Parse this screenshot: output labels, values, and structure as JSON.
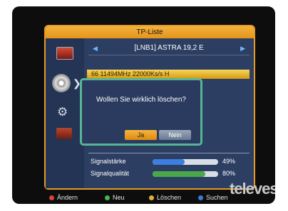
{
  "window": {
    "title": "TP-Liste"
  },
  "satellite": {
    "label": "[LNB1] ASTRA  19,2 E"
  },
  "transponder": {
    "row": "66    11494MHz  22000Ks/s      H"
  },
  "dialog": {
    "question": "Wollen Sie wirklich löschen?",
    "yes": "Ja",
    "no": "Nein"
  },
  "signal": {
    "strength_label": "Signalstärke",
    "strength_value": 49,
    "strength_text": "49%",
    "quality_label": "Signalqualität",
    "quality_value": 80,
    "quality_text": "80%"
  },
  "legend": [
    {
      "label": "Ändern",
      "color": "#d9433b"
    },
    {
      "label": "Neu",
      "color": "#43b84a"
    },
    {
      "label": "Löschen",
      "color": "#e0b040"
    },
    {
      "label": "Suchen",
      "color": "#3d78d8"
    }
  ],
  "brand": {
    "logo_text": "televes"
  },
  "colors": {
    "strength": "#3b7fe0",
    "quality": "#4aa84a"
  },
  "icons": [
    "tv-icon",
    "disc-icon",
    "gear-icon",
    "case-icon"
  ]
}
